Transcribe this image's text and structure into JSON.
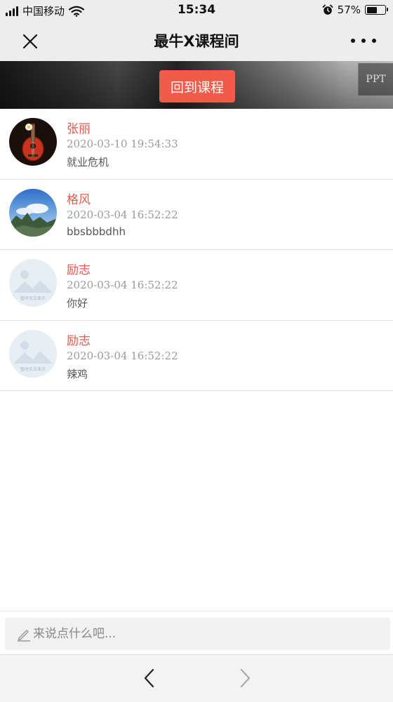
{
  "status_bar": {
    "carrier": "中国移动",
    "time": "15:34",
    "battery": "57%",
    "battery_level": 0.57,
    "icons": [
      "signal-icon",
      "wifi-icon",
      "alarm-icon",
      "battery-icon"
    ]
  },
  "nav": {
    "title": "最牛X课程间",
    "close_icon": "close-icon",
    "more_icon": "more-icon"
  },
  "banner": {
    "back_button": "回到课程",
    "side_tab": "PPT"
  },
  "comments": [
    {
      "name": "张丽",
      "time": "2020-03-10 19:54:33",
      "text": "就业危机",
      "avatar": "guitar"
    },
    {
      "name": "格风",
      "time": "2020-03-04 16:52:22",
      "text": "bbsbbbdhh",
      "avatar": "landscape"
    },
    {
      "name": "励志",
      "time": "2020-03-04 16:52:22",
      "text": "你好",
      "avatar": "placeholder"
    },
    {
      "name": "励志",
      "time": "2020-03-04 16:52:22",
      "text": "辣鸡",
      "avatar": "placeholder"
    }
  ],
  "placeholder_avatar_text": "暂时无法显示",
  "input": {
    "placeholder": "来说点什么吧...",
    "value": "",
    "icon": "pencil-icon"
  },
  "browser": {
    "back_icon": "chevron-left-icon",
    "forward_icon": "chevron-right-icon"
  },
  "colors": {
    "accent": "#f25a4a",
    "name_color": "#e8584a",
    "bar_bg": "#ededed"
  }
}
